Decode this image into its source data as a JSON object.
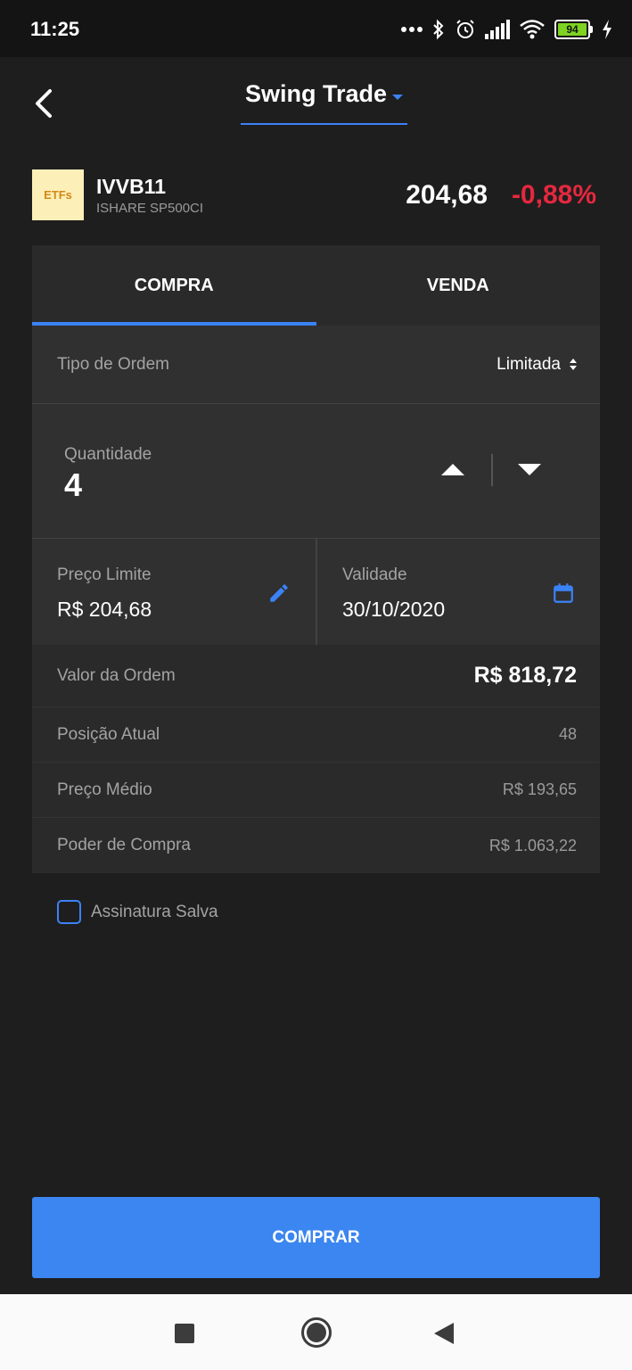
{
  "status_bar": {
    "time": "11:25",
    "icons": [
      "more-dots-icon",
      "bluetooth-icon",
      "alarm-icon",
      "signal-icon",
      "wifi-icon",
      "battery-icon",
      "charging-icon"
    ],
    "battery": "94"
  },
  "header": {
    "title": "Swing Trade",
    "back_icon": "chevron-left-icon",
    "dropdown_icon": "caret-down-icon"
  },
  "asset": {
    "logo_text": "ETFs",
    "ticker": "IVVB11",
    "name": "ISHARE SP500CI",
    "price": "204,68",
    "change": "-0,88%"
  },
  "tabs": [
    {
      "label": "COMPRA",
      "active": true
    },
    {
      "label": "VENDA",
      "active": false
    }
  ],
  "order_form": {
    "order_type_label": "Tipo de Ordem",
    "order_type_value": "Limitada",
    "quantity_label": "Quantidade",
    "quantity_value": "4",
    "price_label": "Preço Limite",
    "price_value": "R$ 204,68",
    "validity_label": "Validade",
    "validity_value": "30/10/2020"
  },
  "summary": [
    {
      "label": "Valor da Ordem",
      "value": "R$ 818,72"
    },
    {
      "label": "Posição Atual",
      "value": "48"
    },
    {
      "label": "Preço Médio",
      "value": "R$ 193,65"
    },
    {
      "label": "Poder de Compra",
      "value": "R$ 1.063,22"
    }
  ],
  "signature": {
    "label": "Assinatura Salva",
    "checked": false
  },
  "buy_button": {
    "label": "COMPRAR"
  },
  "colors": {
    "accent": "#3b82f6",
    "negative": "#e5283f",
    "background": "#1e1e1e"
  }
}
